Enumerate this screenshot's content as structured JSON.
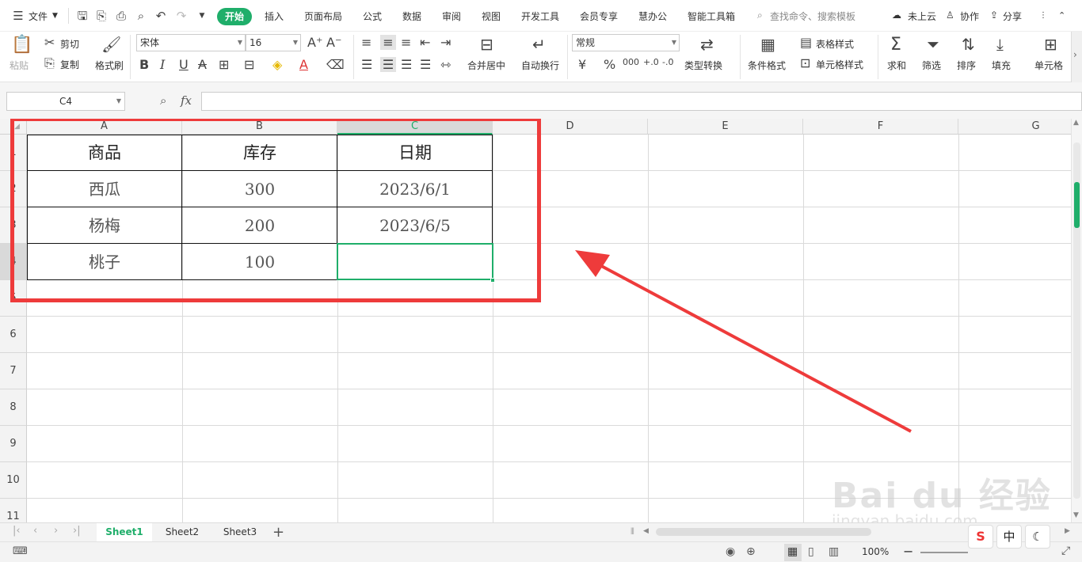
{
  "menubar": {
    "file_label": "文件",
    "tabs": [
      "开始",
      "插入",
      "页面布局",
      "公式",
      "数据",
      "审阅",
      "视图",
      "开发工具",
      "会员专享",
      "慧办公",
      "智能工具箱"
    ],
    "search_placeholder": "查找命令、搜索模板",
    "cloud_label": "未上云",
    "collab_label": "协作",
    "share_label": "分享"
  },
  "ribbon": {
    "paste_label": "粘贴",
    "cut_label": "剪切",
    "copy_label": "复制",
    "format_painter_label": "格式刷",
    "font_name": "宋体",
    "font_size": "16",
    "merge_label": "合并居中",
    "wrap_label": "自动换行",
    "number_format": "常规",
    "type_convert_label": "类型转换",
    "cond_format_label": "条件格式",
    "table_style_label": "表格样式",
    "cell_style_label": "单元格样式",
    "sum_label": "求和",
    "filter_label": "筛选",
    "sort_label": "排序",
    "fill_label": "填充",
    "cell_label": "单元格"
  },
  "formulabar": {
    "cell_ref": "C4",
    "fx_label": "fx",
    "formula_value": ""
  },
  "sheet": {
    "columns": [
      "A",
      "B",
      "C",
      "D",
      "E",
      "F",
      "G"
    ],
    "selected_column": "C",
    "rows": [
      "1",
      "2",
      "3",
      "4",
      "5",
      "6",
      "7",
      "8",
      "9",
      "10",
      "11"
    ],
    "selected_row": "4",
    "cells": {
      "header": [
        "商品",
        "库存",
        "日期"
      ],
      "row2": [
        "西瓜",
        "300",
        "2023/6/1"
      ],
      "row3": [
        "杨梅",
        "200",
        "2023/6/5"
      ],
      "row4": [
        "桃子",
        "100",
        ""
      ]
    }
  },
  "sheettabs": [
    "Sheet1",
    "Sheet2",
    "Sheet3"
  ],
  "active_sheet": "Sheet1",
  "statusbar": {
    "zoom": "100%"
  },
  "ime": {
    "mode_label": "中"
  },
  "watermark": {
    "brand": "Bai du 经验",
    "url": "jingyan.baidu.com"
  },
  "colors": {
    "accent": "#1fae6a",
    "highlight_box": "#ee3b3b",
    "arrow": "#ee3b3b"
  }
}
